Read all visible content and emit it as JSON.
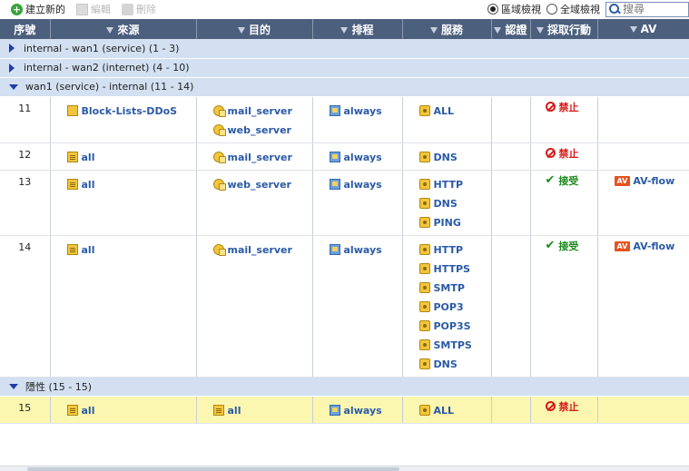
{
  "toolbar": {
    "create_label": "建立新的",
    "edit_label": "編輯",
    "delete_label": "刪除",
    "view_section_label": "區域檢視",
    "view_global_label": "全域檢視",
    "search_placeholder": "搜尋",
    "selected_view": "區域檢視"
  },
  "columns": [
    "序號",
    "來源",
    "目的",
    "排程",
    "服務",
    "認證",
    "採取行動",
    "AV"
  ],
  "groups": [
    {
      "label": "internal - wan1 (service) (1 - 3)",
      "expanded": false
    },
    {
      "label": "internal - wan2 (internet) (4 - 10)",
      "expanded": false
    },
    {
      "label": "wan1 (service) - internal (11 - 14)",
      "expanded": true
    },
    {
      "label": "隱性 (15 - 15)",
      "expanded": true
    }
  ],
  "rows": [
    {
      "seq": "11",
      "source": "Block-Lists-DDoS",
      "destinations": [
        "mail_server",
        "web_server"
      ],
      "schedule": "always",
      "services": [
        "ALL"
      ],
      "auth": "",
      "action": "禁止",
      "av": ""
    },
    {
      "seq": "12",
      "source": "all",
      "destinations": [
        "mail_server"
      ],
      "schedule": "always",
      "services": [
        "DNS"
      ],
      "auth": "",
      "action": "禁止",
      "av": ""
    },
    {
      "seq": "13",
      "source": "all",
      "destinations": [
        "web_server"
      ],
      "schedule": "always",
      "services": [
        "HTTP",
        "DNS",
        "PING"
      ],
      "auth": "",
      "action": "接受",
      "av_badge": "AV",
      "av": "AV-flow"
    },
    {
      "seq": "14",
      "source": "all",
      "destinations": [
        "mail_server"
      ],
      "schedule": "always",
      "services": [
        "HTTP",
        "HTTPS",
        "SMTP",
        "POP3",
        "POP3S",
        "SMTPS",
        "DNS"
      ],
      "auth": "",
      "action": "接受",
      "av_badge": "AV",
      "av": "AV-flow"
    },
    {
      "seq": "15",
      "source": "all",
      "destinations": [
        "all"
      ],
      "schedule": "always",
      "services": [
        "ALL"
      ],
      "auth": "",
      "action": "禁止",
      "av": ""
    }
  ],
  "colors": {
    "header_bg": "#4c5f7d",
    "group_bg": "#d2e0f1",
    "highlight_row": "#fbf6b0",
    "link": "#2a5aa7",
    "deny": "#d61a1a",
    "accept": "#1c8a1c"
  }
}
